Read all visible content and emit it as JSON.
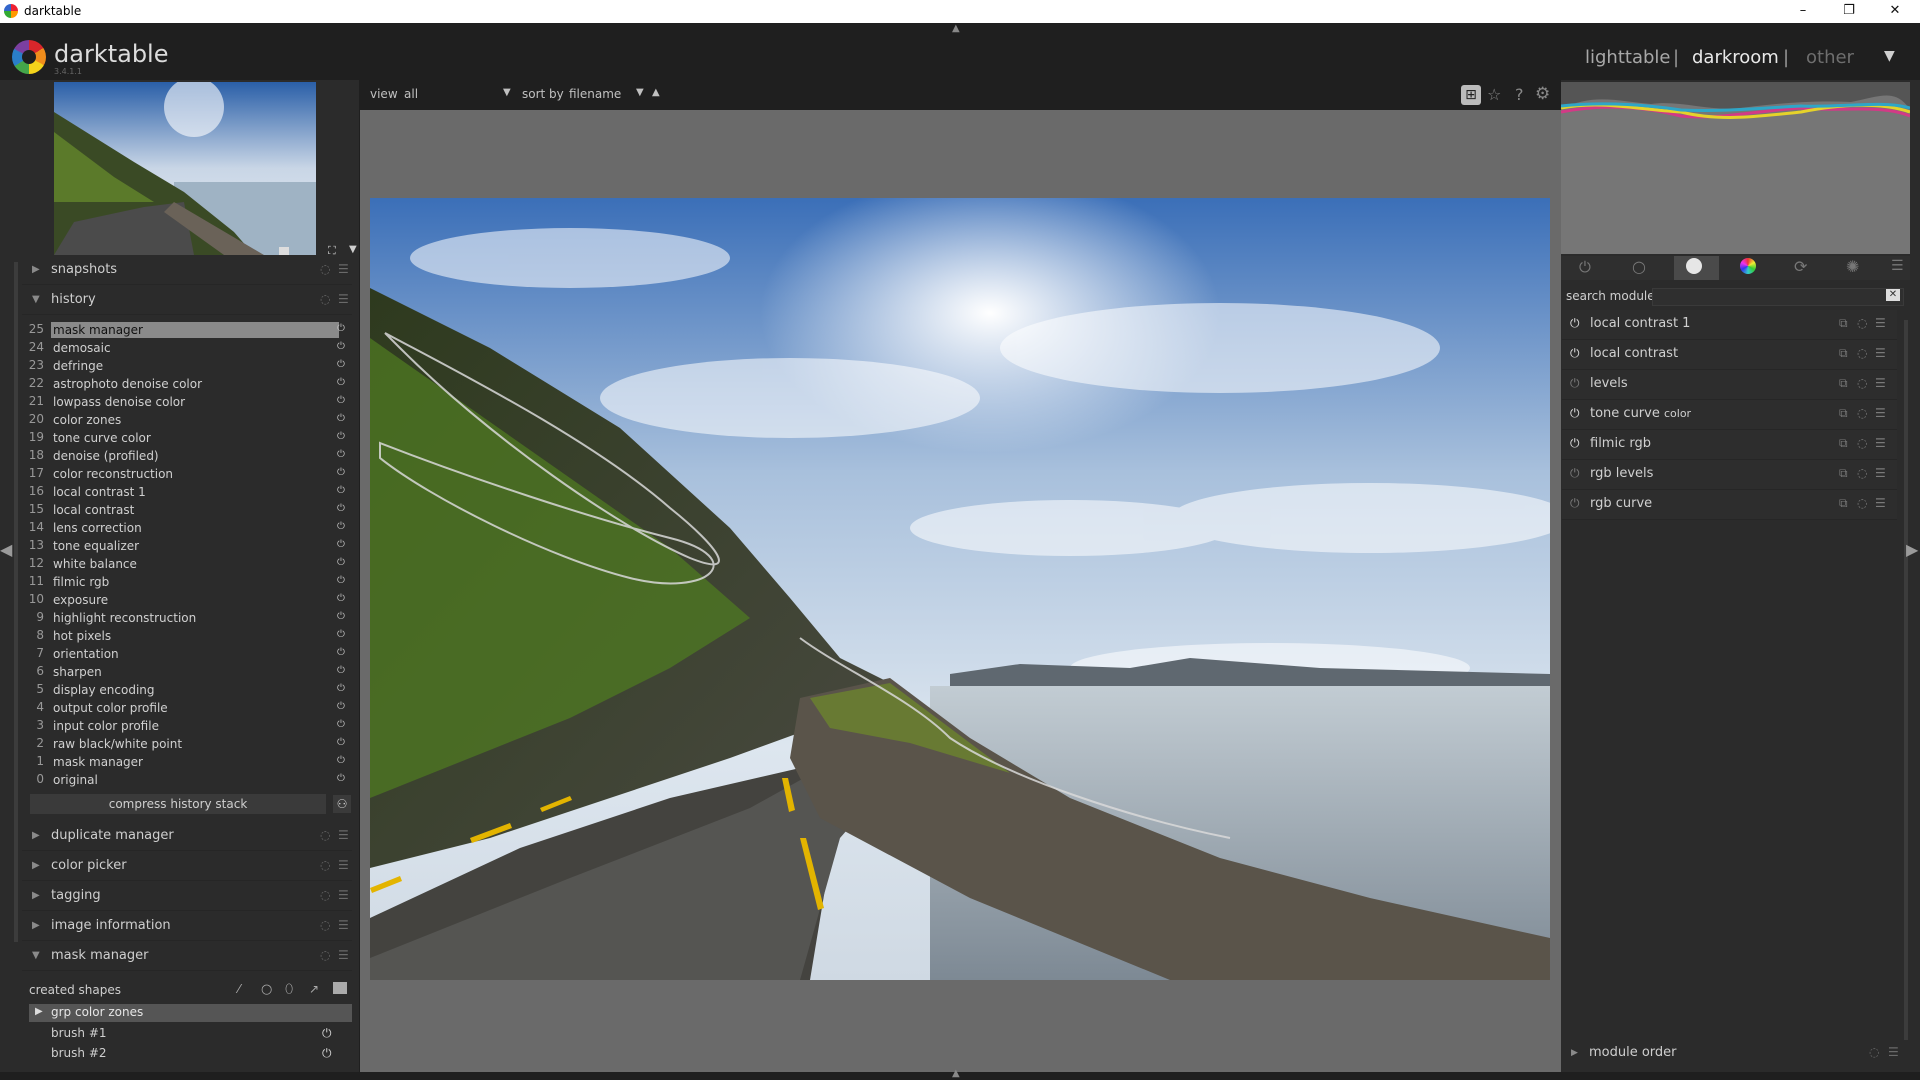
{
  "window": {
    "title": "darktable",
    "minimize": "–",
    "restore": "❐",
    "close": "✕"
  },
  "header": {
    "brand": "darktable",
    "version": "3.4.1.1",
    "views": [
      "lighttable",
      "darkroom",
      "other"
    ],
    "active_view": "darkroom",
    "separator": "|",
    "dropdown_icon": "caret-down-icon"
  },
  "left_panel": {
    "sections_top": [
      {
        "label": "snapshots",
        "collapsed": true
      },
      {
        "label": "history",
        "collapsed": false
      }
    ],
    "history": [
      {
        "num": "25",
        "name": "mask manager",
        "selected": true
      },
      {
        "num": "24",
        "name": "demosaic"
      },
      {
        "num": "23",
        "name": "defringe"
      },
      {
        "num": "22",
        "name": "astrophoto denoise color"
      },
      {
        "num": "21",
        "name": "lowpass denoise color"
      },
      {
        "num": "20",
        "name": "color zones"
      },
      {
        "num": "19",
        "name": "tone curve color"
      },
      {
        "num": "18",
        "name": "denoise (profiled)"
      },
      {
        "num": "17",
        "name": "color reconstruction"
      },
      {
        "num": "16",
        "name": "local contrast 1"
      },
      {
        "num": "15",
        "name": "local contrast"
      },
      {
        "num": "14",
        "name": "lens correction"
      },
      {
        "num": "13",
        "name": "tone equalizer"
      },
      {
        "num": "12",
        "name": "white balance"
      },
      {
        "num": "11",
        "name": "filmic rgb"
      },
      {
        "num": "10",
        "name": "exposure"
      },
      {
        "num": "9",
        "name": "highlight reconstruction"
      },
      {
        "num": "8",
        "name": "hot pixels"
      },
      {
        "num": "7",
        "name": "orientation"
      },
      {
        "num": "6",
        "name": "sharpen"
      },
      {
        "num": "5",
        "name": "display encoding"
      },
      {
        "num": "4",
        "name": "output color profile"
      },
      {
        "num": "3",
        "name": "input color profile"
      },
      {
        "num": "2",
        "name": "raw black/white point"
      },
      {
        "num": "1",
        "name": "mask manager"
      },
      {
        "num": "0",
        "name": "original"
      }
    ],
    "compress_label": "compress history stack",
    "sections_bottom": [
      {
        "label": "duplicate manager",
        "collapsed": true
      },
      {
        "label": "color picker",
        "collapsed": true
      },
      {
        "label": "tagging",
        "collapsed": true
      },
      {
        "label": "image information",
        "collapsed": true
      },
      {
        "label": "mask manager",
        "collapsed": false
      }
    ],
    "mask_manager": {
      "created_shapes_label": "created shapes",
      "group": "grp color zones",
      "shapes": [
        "brush #1",
        "brush #2"
      ]
    }
  },
  "center": {
    "view_label": "view",
    "view_value": "all",
    "sort_label": "sort by",
    "sort_value": "filename",
    "sort_direction": "ascending"
  },
  "right_panel": {
    "search_label": "search module",
    "modules": [
      {
        "label": "local contrast 1",
        "enabled": true
      },
      {
        "label": "local contrast",
        "enabled": true
      },
      {
        "label": "levels",
        "enabled": false
      },
      {
        "label": "tone curve",
        "suffix": "color",
        "enabled": true
      },
      {
        "label": "filmic rgb",
        "enabled": true
      },
      {
        "label": "rgb levels",
        "enabled": false
      },
      {
        "label": "rgb curve",
        "enabled": false
      }
    ],
    "module_order_label": "module order"
  },
  "colors": {
    "accent_bg": "#1f1f1f",
    "panel_bg": "#2b2b2b",
    "center_bg": "#6a6a6a",
    "selected_row": "#8a8a8a"
  }
}
